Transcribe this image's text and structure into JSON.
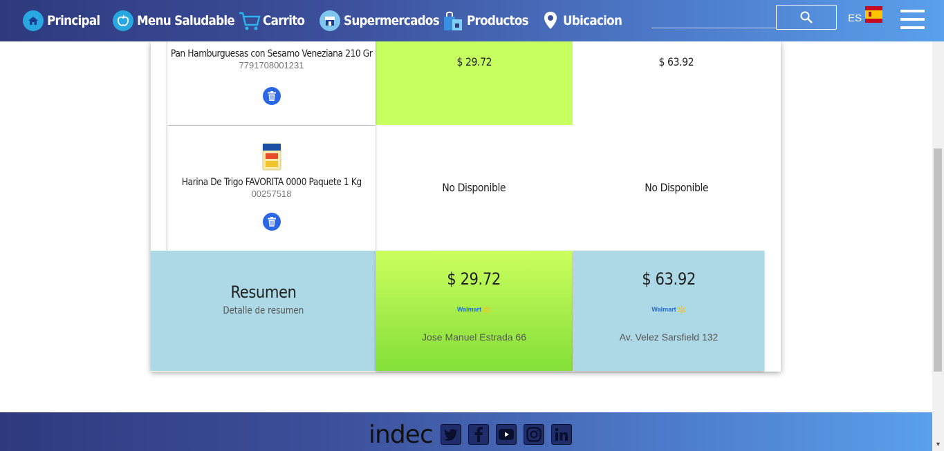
{
  "nav": {
    "items": [
      {
        "label": "Principal",
        "icon": "home-icon"
      },
      {
        "label": "Menu Saludable",
        "icon": "apple-icon"
      },
      {
        "label": "Carrito",
        "icon": "cart-icon"
      },
      {
        "label": "Supermercados",
        "icon": "store-icon"
      },
      {
        "label": "Productos",
        "icon": "shopping-bag-icon"
      },
      {
        "label": "Ubicacion",
        "icon": "location-pin-icon"
      }
    ],
    "search_placeholder": "",
    "language": "ES",
    "flag": "spain-flag-icon"
  },
  "products": [
    {
      "name": "Pan Hamburguesas con Sesamo Veneziana 210 Gr",
      "code": "7791708001231",
      "prices": [
        "$ 29.72",
        "$ 63.92"
      ]
    },
    {
      "name": "Harina De Trigo FAVORITA 0000 Paquete 1 Kg",
      "code": "00257518",
      "prices": [
        "No Disponible",
        "No Disponible"
      ]
    }
  ],
  "summary": {
    "title": "Resumen",
    "subtitle": "Detalle de resumen",
    "stores": [
      {
        "total": "$ 29.72",
        "brand": "Walmart",
        "address": "Jose Manuel Estrada 66"
      },
      {
        "total": "$ 63.92",
        "brand": "Walmart",
        "address": "Av. Velez Sarsfield 132"
      }
    ]
  },
  "footer": {
    "logo": "indec",
    "social": [
      "twitter-icon",
      "facebook-icon",
      "youtube-icon",
      "instagram-icon",
      "linkedin-icon"
    ]
  },
  "colors": {
    "nav_start": "#2f3a7e",
    "nav_end": "#5aa0ea",
    "best_price": "#c8ff60",
    "summary_blue": "#add8e6",
    "trash_button": "#2a66e6"
  }
}
